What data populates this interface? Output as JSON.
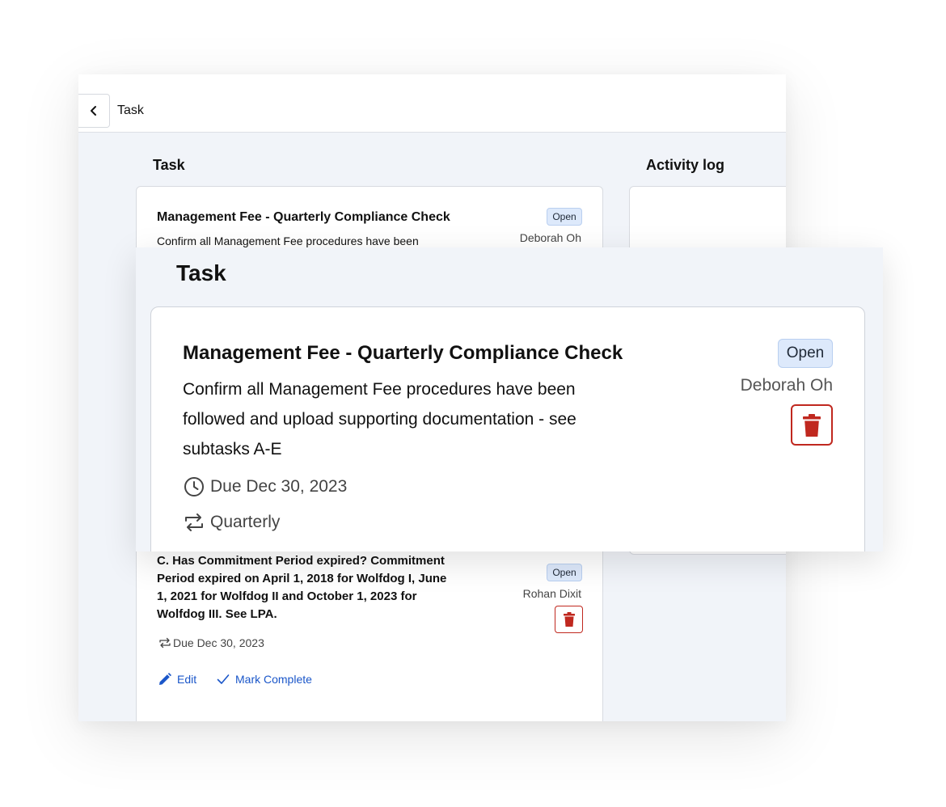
{
  "topbar": {
    "title": "Task"
  },
  "main": {
    "task_heading": "Task",
    "activity_heading": "Activity log",
    "task_card": {
      "title": "Management Fee - Quarterly Compliance Check",
      "description": "Confirm all Management Fee procedures have been",
      "status": "Open",
      "assignee": "Deborah Oh"
    },
    "subtask_card": {
      "title": "C. Has Commitment Period expired? Commitment Period expired on April 1, 2018 for Wolfdog I, June 1, 2021 for Wolfdog II and October 1, 2023 for Wolfdog III. See LPA.",
      "status": "Open",
      "assignee": "Rohan Dixit",
      "due": "Due Dec 30, 2023",
      "edit_label": "Edit",
      "complete_label": "Mark Complete"
    }
  },
  "zoom": {
    "heading": "Task",
    "title": "Management Fee - Quarterly Compliance Check",
    "description": "Confirm all Management Fee procedures have been followed and upload supporting documentation - see subtasks A-E",
    "status": "Open",
    "assignee": "Deborah Oh",
    "due": "Due Dec 30, 2023",
    "recurrence": "Quarterly"
  },
  "colors": {
    "accent": "#1a56c9",
    "danger": "#c0281f",
    "badge_bg": "#dde9fb",
    "page_bg": "#f1f4f9"
  },
  "icons": [
    "chevron-left-icon",
    "trash-icon",
    "clock-icon",
    "repeat-icon",
    "pencil-icon",
    "check-icon"
  ]
}
